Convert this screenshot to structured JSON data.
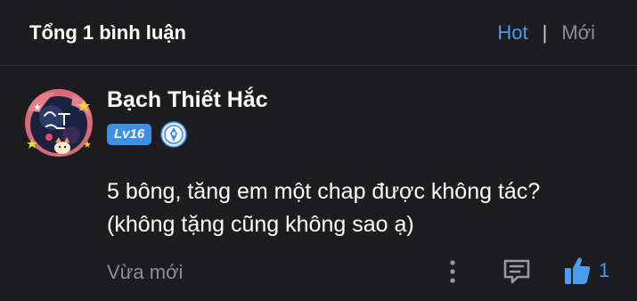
{
  "header": {
    "title": "Tổng 1 bình luận",
    "sort_hot": "Hot",
    "sort_separator": "|",
    "sort_new": "Mới"
  },
  "comment": {
    "username": "Bạch Thiết Hắc",
    "level": "Lv16",
    "avatar_icon": "avatar-image",
    "rank_icon": "rank-badge-icon",
    "text_lines": [
      "5 bông, tăng em một chap được không tác?",
      "(không tặng cũng không sao ạ)"
    ],
    "timestamp": "Vừa mới",
    "like_count": "1"
  },
  "colors": {
    "background": "#1d1d1f",
    "accent": "#4a9df0",
    "muted": "#8e8e93",
    "level_badge": "#3a8fe8"
  }
}
